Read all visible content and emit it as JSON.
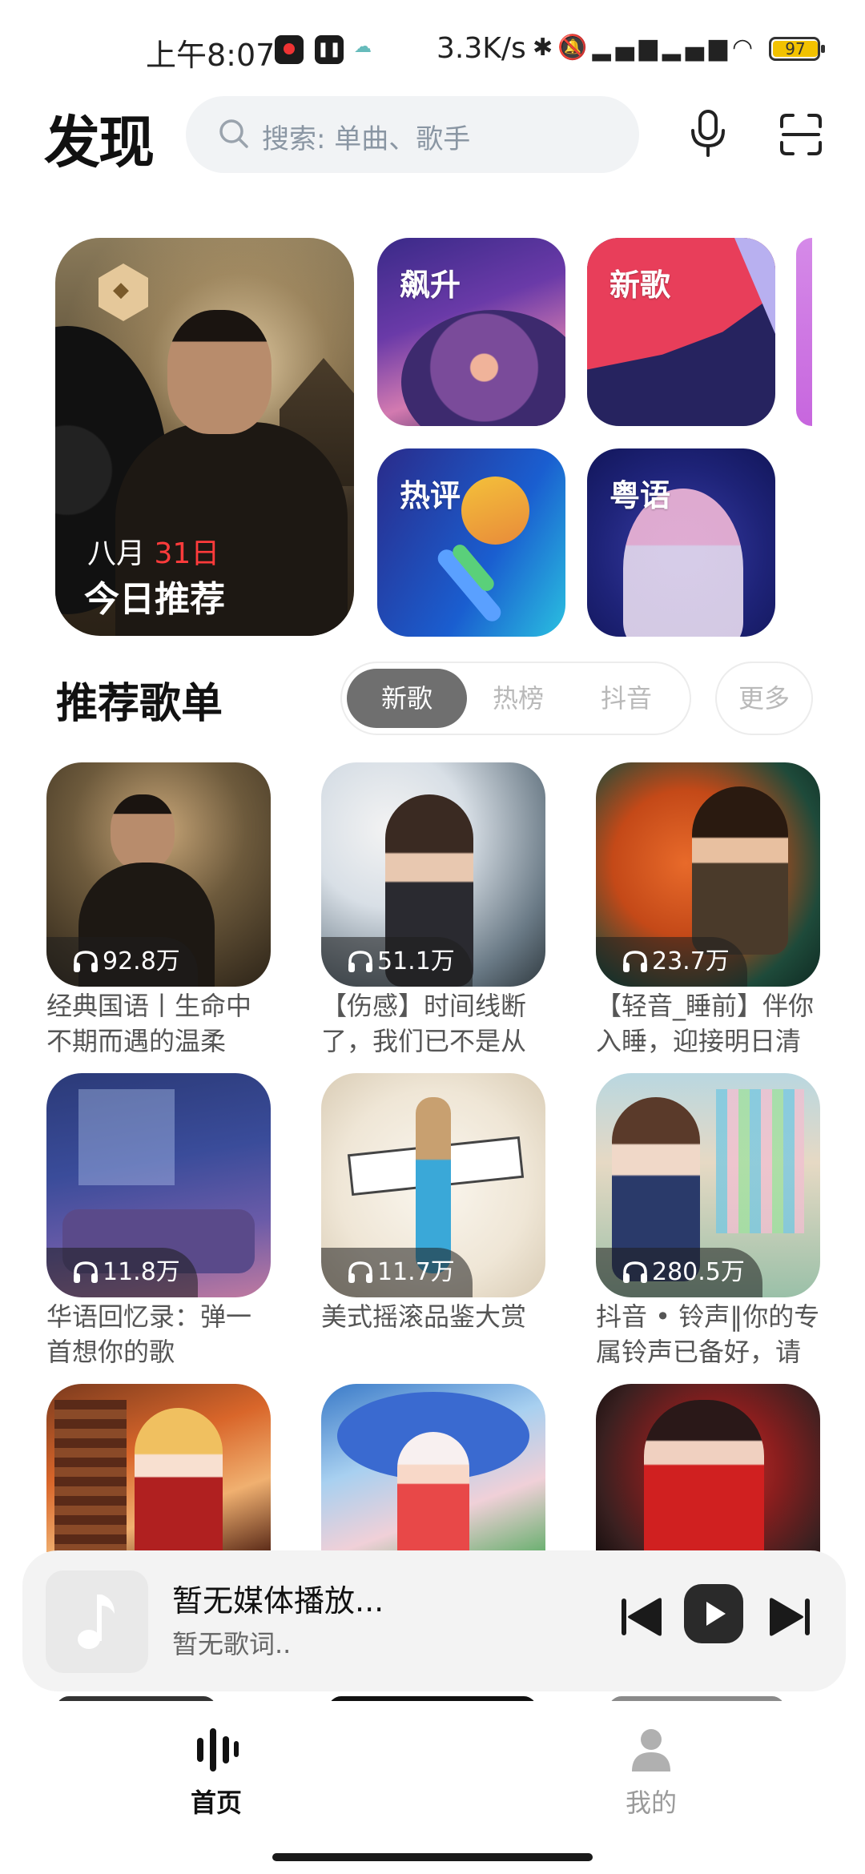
{
  "status_bar": {
    "time": "上午8:07",
    "network_speed": "3.3K/s",
    "battery": "97",
    "icons": [
      "tiktok-app-icon",
      "pause-app-icon",
      "cloud-app-icon",
      "bluetooth-icon",
      "mute-icon",
      "hd-signal-icon",
      "hd-signal-icon",
      "wifi-icon"
    ]
  },
  "header": {
    "title": "发现",
    "search_placeholder": "搜索: 单曲、歌手",
    "icons": [
      "search-icon",
      "microphone-icon",
      "scan-icon"
    ]
  },
  "featured": {
    "daily": {
      "month": "八月",
      "day": "31日",
      "label": "今日推荐"
    },
    "cards": [
      {
        "title": "飙升"
      },
      {
        "title": "新歌"
      },
      {
        "title": "热评"
      },
      {
        "title": "粤语"
      }
    ]
  },
  "playlist_section": {
    "title": "推荐歌单",
    "tabs": [
      {
        "label": "新歌",
        "active": true
      },
      {
        "label": "热榜",
        "active": false
      },
      {
        "label": "抖音",
        "active": false
      }
    ],
    "more_label": "更多",
    "playlists": [
      {
        "count": "92.8万",
        "name": "经典国语丨生命中不期而遇的温柔"
      },
      {
        "count": "51.1万",
        "name": "【伤感】时间线断了，我们已不是从"
      },
      {
        "count": "23.7万",
        "name": "【轻音_睡前】伴你入睡，迎接明日清"
      },
      {
        "count": "11.8万",
        "name": "华语回忆录：弹一首想你的歌"
      },
      {
        "count": "11.7万",
        "name": "美式摇滚品鉴大赏"
      },
      {
        "count": "280.5万",
        "name": "抖音 • 铃声‖你的专属铃声已备好，请"
      },
      {
        "count": "",
        "name": ""
      },
      {
        "count": "",
        "name": ""
      },
      {
        "count": "",
        "name": ""
      }
    ]
  },
  "player": {
    "title": "暂无媒体播放...",
    "subtitle": "暂无歌词.."
  },
  "bottom_nav": {
    "items": [
      {
        "label": "首页",
        "active": true
      },
      {
        "label": "我的",
        "active": false
      }
    ]
  },
  "colors": {
    "accent_red": "#ff3b3b",
    "active_tab_bg": "#6f6f6f",
    "search_bg": "#f1f3f5"
  }
}
